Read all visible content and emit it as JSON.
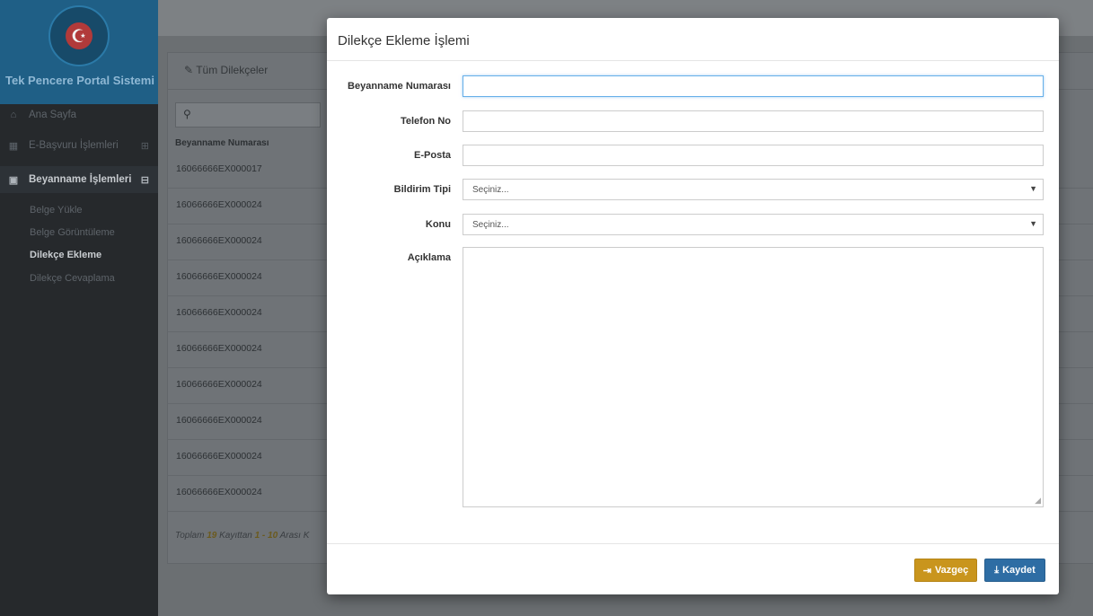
{
  "sidebar": {
    "brand": "Tek Pencere Portal Sistemi",
    "logo_glyph": "☪",
    "items": [
      {
        "label": "Ana Sayfa",
        "icon": "home-icon",
        "glyph": "⌂"
      },
      {
        "label": "E-Başvuru İşlemleri",
        "icon": "chart-icon",
        "glyph": "▦",
        "toggle": "⊞"
      },
      {
        "label": "Beyanname İşlemleri",
        "icon": "image-icon",
        "glyph": "▣",
        "toggle": "⊟"
      }
    ],
    "subitems": [
      {
        "label": "Belge Yükle"
      },
      {
        "label": "Belge Görüntüleme"
      },
      {
        "label": "Dilekçe Ekleme"
      },
      {
        "label": "Dilekçe Cevaplama"
      }
    ]
  },
  "background": {
    "panel_title": "Tüm Dilekçeler",
    "panel_icon": "edit-icon",
    "search_icon": "search-icon",
    "column_header": "Beyanname Numarası",
    "rows": [
      "16066666EX000017",
      "16066666EX000024",
      "16066666EX000024",
      "16066666EX000024",
      "16066666EX000024",
      "16066666EX000024",
      "16066666EX000024",
      "16066666EX000024",
      "16066666EX000024",
      "16066666EX000024"
    ],
    "footer": {
      "prefix": "Toplam ",
      "total": "19",
      "middle": " Kayıttan ",
      "range": "1 - 10",
      "suffix": " Arası K"
    }
  },
  "modal": {
    "title": "Dilekçe Ekleme İşlemi",
    "fields": {
      "beyanname_label": "Beyanname Numarası",
      "beyanname_value": "",
      "telefon_label": "Telefon No",
      "telefon_value": "",
      "eposta_label": "E-Posta",
      "eposta_value": "",
      "bildirim_label": "Bildirim Tipi",
      "bildirim_value": "Seçiniz...",
      "konu_label": "Konu",
      "konu_value": "Seçiniz...",
      "aciklama_label": "Açıklama",
      "aciklama_value": ""
    },
    "buttons": {
      "cancel_label": "Vazgeç",
      "save_label": "Kaydet"
    },
    "colors": {
      "cancel": "#c9951d",
      "save": "#2e6da4"
    }
  }
}
